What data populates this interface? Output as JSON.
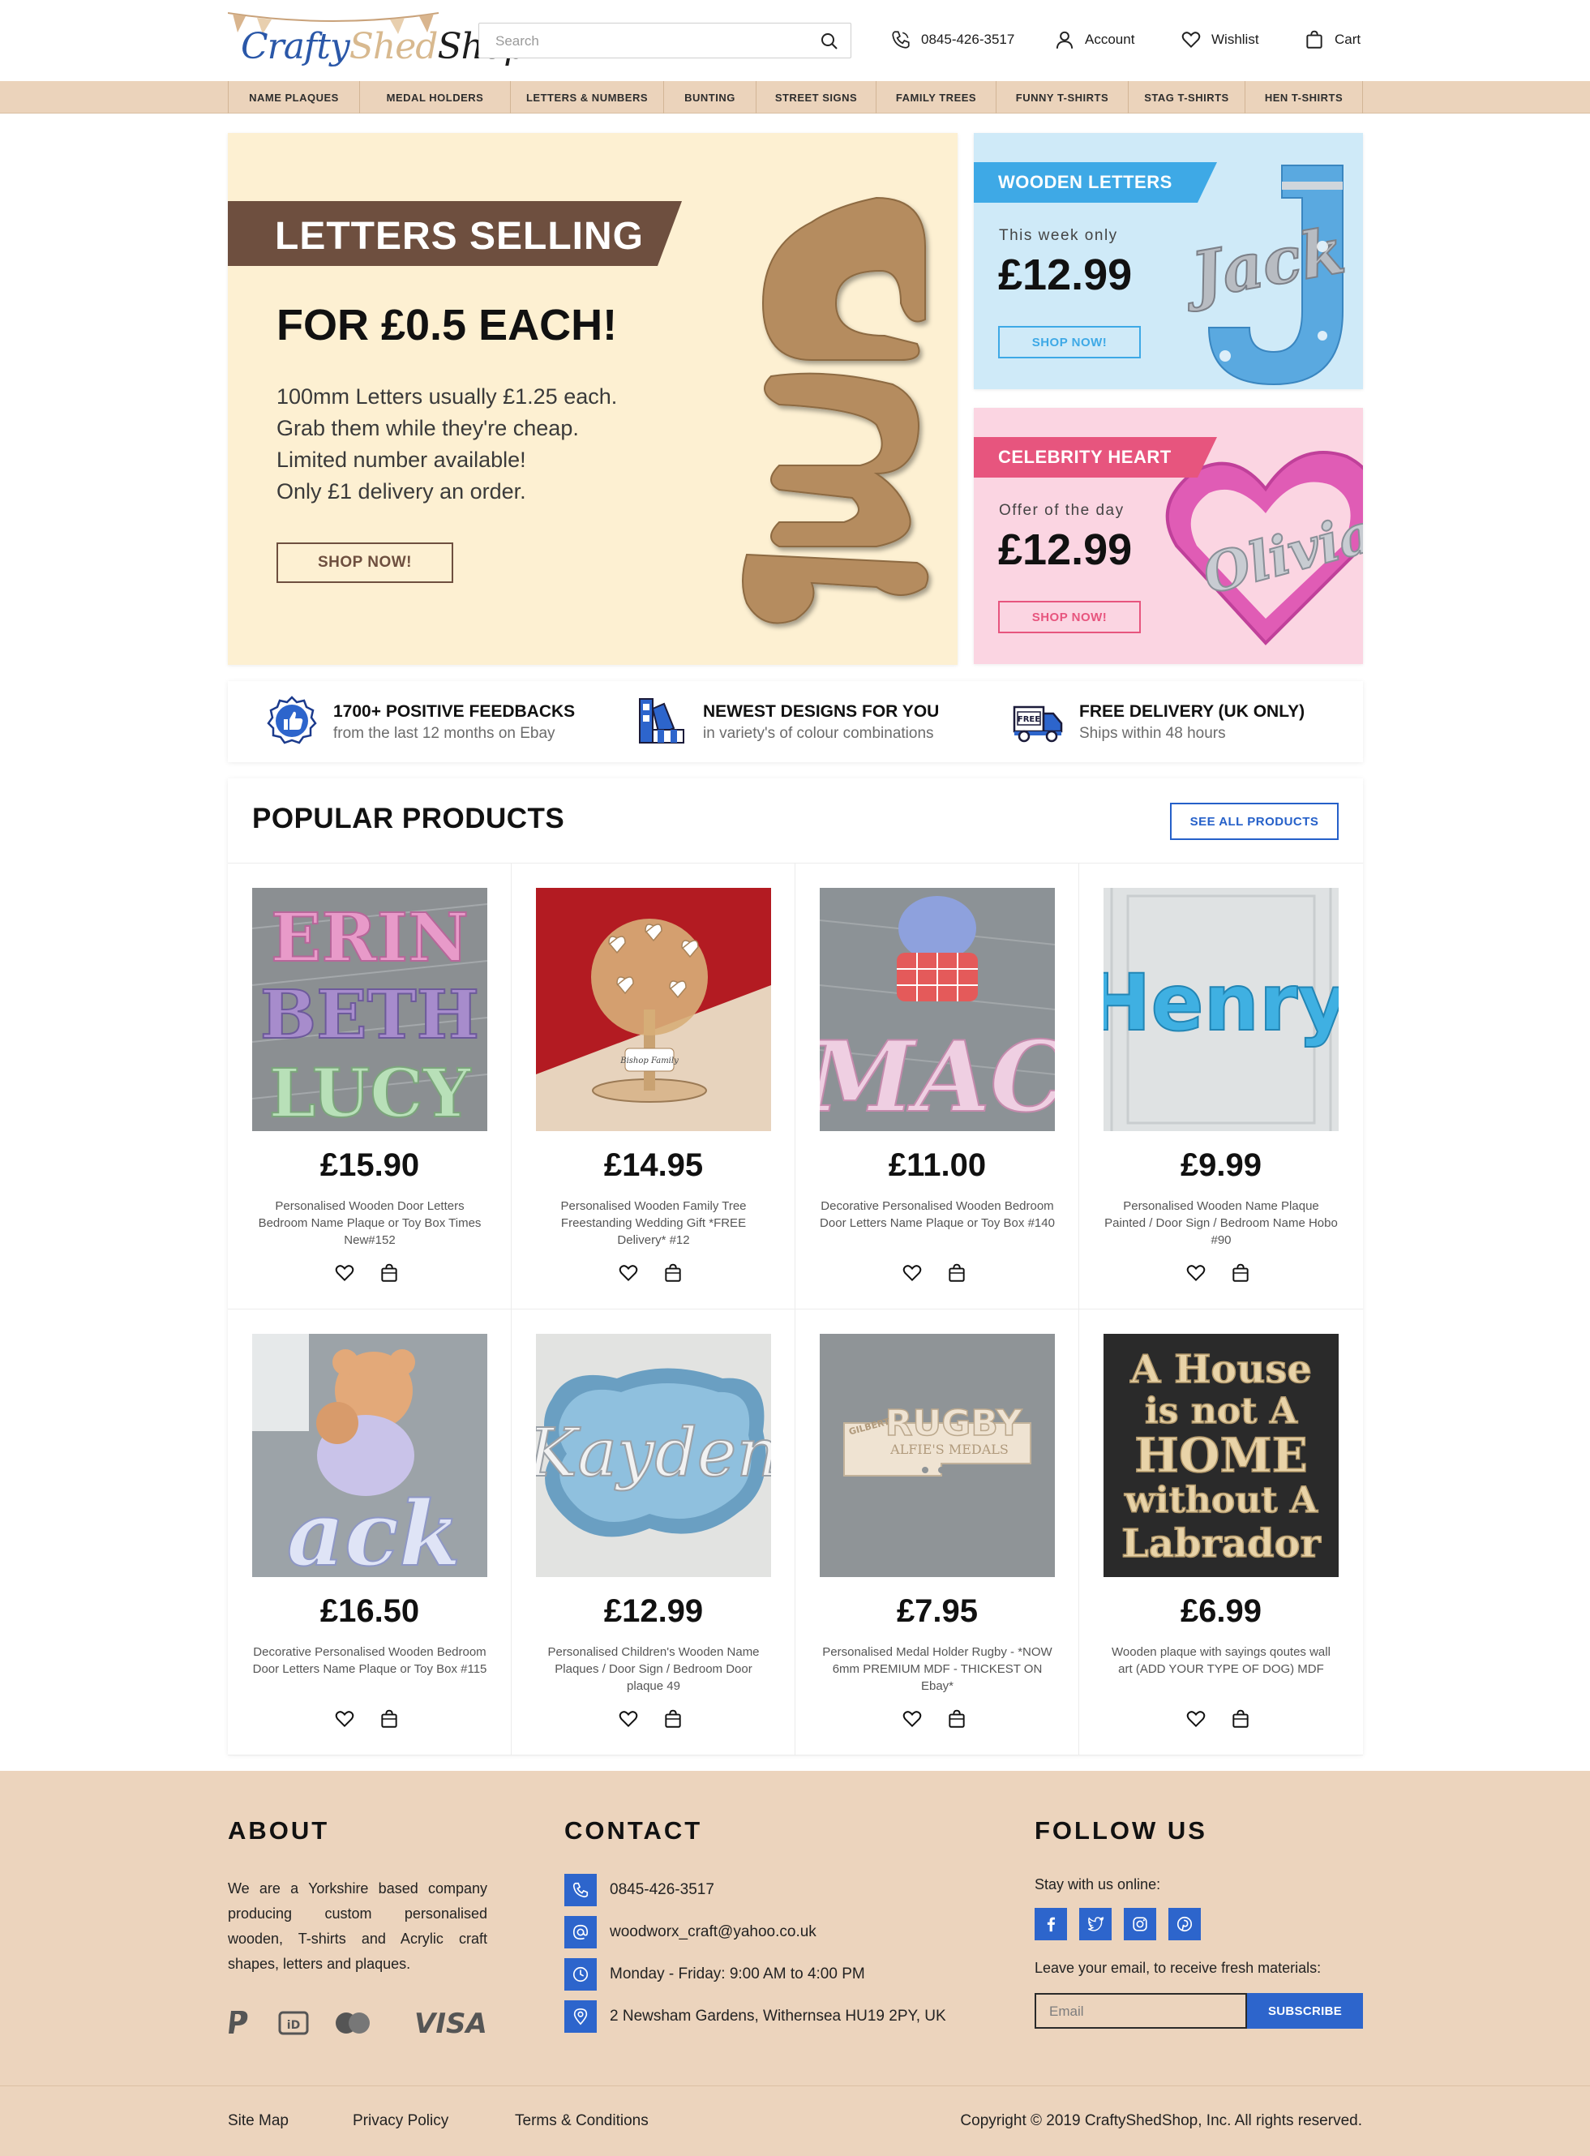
{
  "header": {
    "logo": {
      "part1": "Crafty",
      "part2": "Shed",
      "part3": "Shop"
    },
    "search_placeholder": "Search",
    "phone": "0845-426-3517",
    "account": "Account",
    "wishlist": "Wishlist",
    "cart": "Cart"
  },
  "nav": [
    "NAME PLAQUES",
    "MEDAL HOLDERS",
    "LETTERS & NUMBERS",
    "BUNTING",
    "STREET SIGNS",
    "FAMILY TREES",
    "FUNNY T-SHIRTS",
    "STAG T-SHIRTS",
    "HEN T-SHIRTS"
  ],
  "hero": {
    "ribbon": "LETTERS SELLING",
    "headline": "FOR £0.5 EACH!",
    "lines": [
      "100mm Letters usually £1.25 each.",
      "Grab them while they're cheap.",
      "Limited number available!",
      "Only £1 delivery an order."
    ],
    "button": "SHOP NOW!"
  },
  "promos": [
    {
      "tag": "WOODEN LETTERS",
      "note": "This week only",
      "price": "£12.99",
      "button": "SHOP NOW!",
      "accent": "#3ea9e6"
    },
    {
      "tag": "CELEBRITY HEART",
      "note": "Offer of the day",
      "price": "£12.99",
      "button": "SHOP NOW!",
      "accent": "#e7557e"
    }
  ],
  "features": [
    {
      "title": "1700+ POSITIVE FEEDBACKS",
      "sub": "from the last 12 months on Ebay",
      "icon": "thumbs-up-badge-icon"
    },
    {
      "title": "NEWEST DESIGNS FOR YOU",
      "sub": "in variety's of colour combinations",
      "icon": "color-swatch-icon"
    },
    {
      "title": "FREE DELIVERY (UK ONLY)",
      "sub": "Ships within 48 hours",
      "icon": "delivery-truck-icon"
    }
  ],
  "products_section": {
    "title": "POPULAR PRODUCTS",
    "see_all": "SEE ALL PRODUCTS",
    "items": [
      {
        "price": "£15.90",
        "name": "Personalised Wooden Door Letters Bedroom Name Plaque or Toy Box Times New#152"
      },
      {
        "price": "£14.95",
        "name": "Personalised Wooden Family Tree Freestanding Wedding Gift *FREE Delivery* #12"
      },
      {
        "price": "£11.00",
        "name": "Decorative Personalised Wooden Bedroom Door Letters Name Plaque or Toy Box #140"
      },
      {
        "price": "£9.99",
        "name": "Personalised Wooden Name Plaque Painted / Door Sign / Bedroom Name Hobo #90"
      },
      {
        "price": "£16.50",
        "name": "Decorative Personalised Wooden Bedroom Door Letters Name Plaque or Toy Box #115"
      },
      {
        "price": "£12.99",
        "name": "Personalised Children's Wooden Name Plaques / Door Sign / Bedroom Door plaque 49"
      },
      {
        "price": "£7.95",
        "name": "Personalised Medal Holder Rugby - *NOW 6mm PREMIUM MDF - THICKEST ON Ebay*"
      },
      {
        "price": "£6.99",
        "name": "Wooden plaque with sayings qoutes wall art (ADD YOUR TYPE OF DOG) MDF"
      }
    ],
    "image_text": {
      "erin": "ERIN",
      "beth": "BETH",
      "lucy": "LUCY",
      "tree_plate": "Bishop Family",
      "jack_lower": "ack",
      "henry": "Henry",
      "mack": "ack",
      "kayden": "Kayden",
      "rugby": "RUGBY",
      "gilbert": "GILBERT",
      "medals": "ALFIE'S MEDALS",
      "house1": "A House",
      "house2": "is not A",
      "house3": "HOME",
      "house4": "without A",
      "house5": "Labrador"
    }
  },
  "footer": {
    "about_title": "ABOUT",
    "about_text": "We are a Yorkshire based company producing custom personalised wooden, T-shirts and Acrylic craft shapes, letters and plaques.",
    "contact_title": "CONTACT",
    "contacts": [
      {
        "text": "0845-426-3517",
        "icon": "phone-icon"
      },
      {
        "text": "woodworx_craft@yahoo.co.uk",
        "icon": "at-icon"
      },
      {
        "text": "Monday - Friday: 9:00 AM to 4:00 PM",
        "icon": "clock-icon"
      },
      {
        "text": "2 Newsham Gardens, Withernsea HU19 2PY, UK",
        "icon": "location-pin-icon"
      }
    ],
    "follow_title": "FOLLOW US",
    "stay_text": "Stay with us online:",
    "email_text": "Leave your email, to receive fresh materials:",
    "email_placeholder": "Email",
    "subscribe": "SUBSCRIBE",
    "payments": {
      "ideal": "iD",
      "visa": "VISA"
    },
    "links": [
      "Site Map",
      "Privacy Policy",
      "Terms & Conditions"
    ],
    "copyright": "Copyright © 2019 CraftyShedShop, Inc. All rights reserved."
  }
}
